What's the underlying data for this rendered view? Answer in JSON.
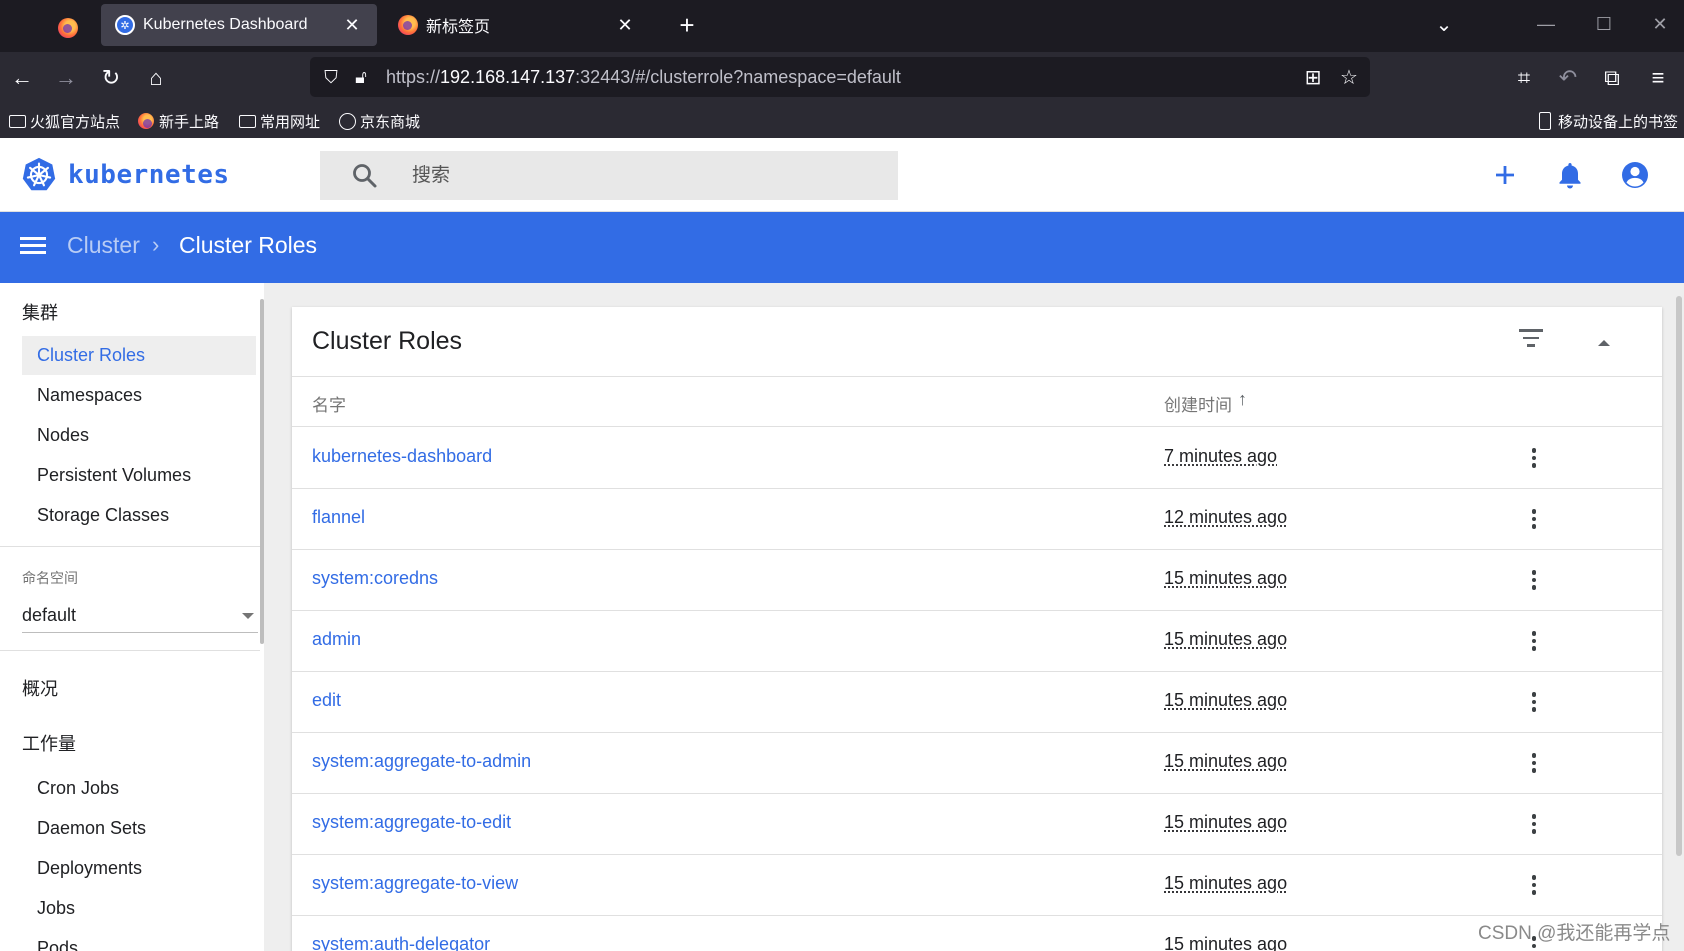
{
  "browser": {
    "tabs": [
      {
        "title": "Kubernetes Dashboard",
        "active": true
      },
      {
        "title": "新标签页",
        "active": false
      }
    ],
    "url": {
      "scheme": "https://",
      "host": "192.168.147.137",
      "rest": ":32443/#/clusterrole?namespace=default"
    },
    "bookmarks": [
      "火狐官方站点",
      "新手上路",
      "常用网址",
      "京东商城"
    ],
    "mobile_bookmarks": "移动设备上的书签"
  },
  "app": {
    "logo_text": "kubernetes",
    "search_placeholder": "搜索",
    "accent_color": "#326ce5"
  },
  "breadcrumb": {
    "parent": "Cluster",
    "current": "Cluster Roles"
  },
  "sidebar": {
    "cluster_section": "集群",
    "cluster_items": [
      "Cluster Roles",
      "Namespaces",
      "Nodes",
      "Persistent Volumes",
      "Storage Classes"
    ],
    "active_item": "Cluster Roles",
    "namespace_label": "命名空间",
    "namespace_value": "default",
    "overview_section": "概况",
    "workloads_section": "工作量",
    "workload_items": [
      "Cron Jobs",
      "Daemon Sets",
      "Deployments",
      "Jobs",
      "Pods"
    ]
  },
  "table": {
    "title": "Cluster Roles",
    "columns": {
      "name": "名字",
      "created": "创建时间"
    },
    "rows": [
      {
        "name": "kubernetes-dashboard",
        "created": "7 minutes ago"
      },
      {
        "name": "flannel",
        "created": "12 minutes ago"
      },
      {
        "name": "system:coredns",
        "created": "15 minutes ago"
      },
      {
        "name": "admin",
        "created": "15 minutes ago"
      },
      {
        "name": "edit",
        "created": "15 minutes ago"
      },
      {
        "name": "system:aggregate-to-admin",
        "created": "15 minutes ago"
      },
      {
        "name": "system:aggregate-to-edit",
        "created": "15 minutes ago"
      },
      {
        "name": "system:aggregate-to-view",
        "created": "15 minutes ago"
      },
      {
        "name": "system:auth-delegator",
        "created": "15 minutes ago"
      }
    ]
  },
  "watermark": "CSDN @我还能再学点"
}
